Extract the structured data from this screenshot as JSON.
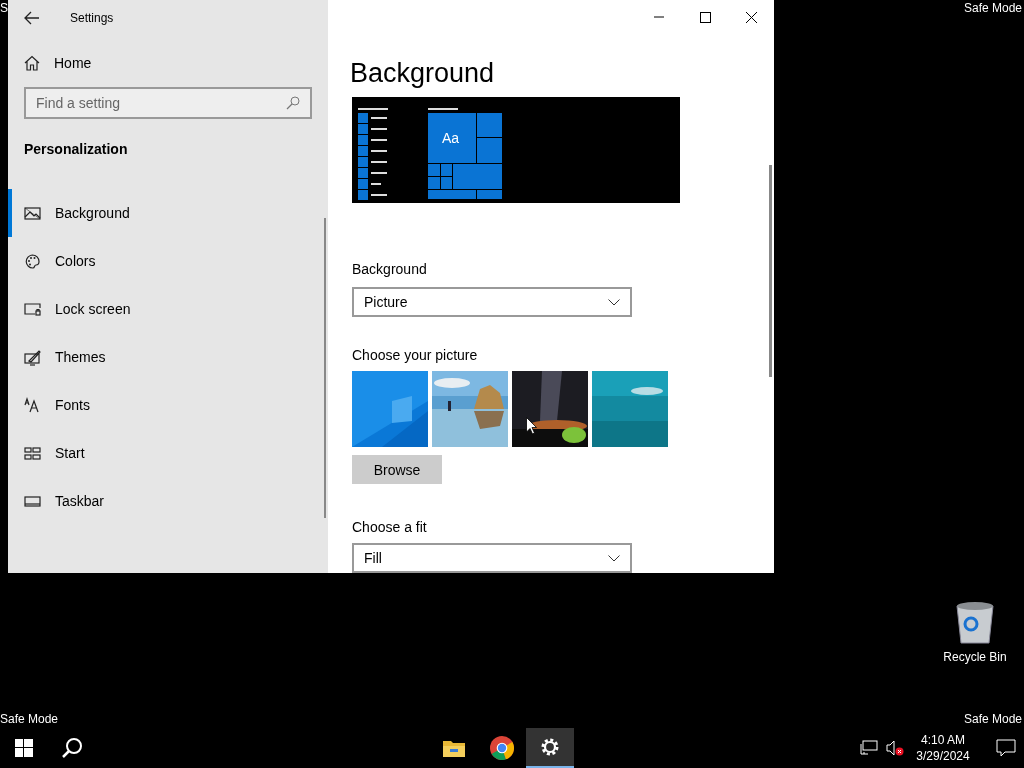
{
  "desktop_labels": {
    "top_left": "S",
    "top_right": "Safe Mode",
    "bottom_left": "Safe Mode",
    "bottom_right": "Safe Mode"
  },
  "window": {
    "title": "Settings"
  },
  "sidebar": {
    "home": "Home",
    "search": {
      "placeholder": "Find a setting"
    },
    "section": "Personalization",
    "items": [
      {
        "label": "Background",
        "kind": "picture",
        "selected": true
      },
      {
        "label": "Colors",
        "kind": "palette",
        "selected": false
      },
      {
        "label": "Lock screen",
        "kind": "lock",
        "selected": false
      },
      {
        "label": "Themes",
        "kind": "brush",
        "selected": false
      },
      {
        "label": "Fonts",
        "kind": "fonts",
        "selected": false
      },
      {
        "label": "Start",
        "kind": "start",
        "selected": false
      },
      {
        "label": "Taskbar",
        "kind": "taskbar",
        "selected": false
      }
    ]
  },
  "content": {
    "heading": "Background",
    "preview": {
      "tile_text": "Aa"
    },
    "background": {
      "label": "Background",
      "value": "Picture"
    },
    "pictures": {
      "label": "Choose your picture"
    },
    "browse_button": "Browse",
    "fit": {
      "label": "Choose a fit",
      "value": "Fill"
    }
  },
  "recycle_bin": {
    "label": "Recycle Bin"
  },
  "taskbar": {
    "apps": [
      {
        "kind": "folder",
        "selected": false
      },
      {
        "kind": "browser",
        "selected": false
      },
      {
        "kind": "gear",
        "selected": true
      }
    ],
    "clock": {
      "time": "4:10 AM",
      "date": "3/29/2024"
    }
  }
}
